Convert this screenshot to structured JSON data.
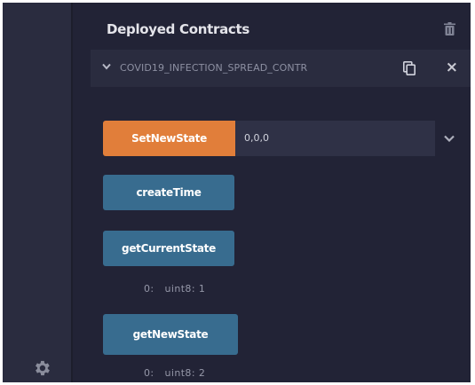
{
  "sidebar": {
    "settings_icon": "gear-icon"
  },
  "header": {
    "title": "Deployed Contracts",
    "delete_icon": "trash-icon"
  },
  "contract": {
    "name": "COVID19_INFECTION_SPREAD_CONTR",
    "expand_icon": "chevron-down-icon",
    "copy_icon": "copy-icon",
    "close_label": "×"
  },
  "functions": [
    {
      "label": "SetNewState",
      "input_value": "0,0,0",
      "color": "#e17e3a"
    },
    {
      "label": "createTime",
      "color": "#386c8f"
    },
    {
      "label": "getCurrentState",
      "color": "#386c8f",
      "output_index": "0:",
      "output_value": "uint8: 1"
    },
    {
      "label": "getNewState",
      "color": "#386c8f",
      "output_index": "0:",
      "output_value": "uint8: 2"
    }
  ]
}
